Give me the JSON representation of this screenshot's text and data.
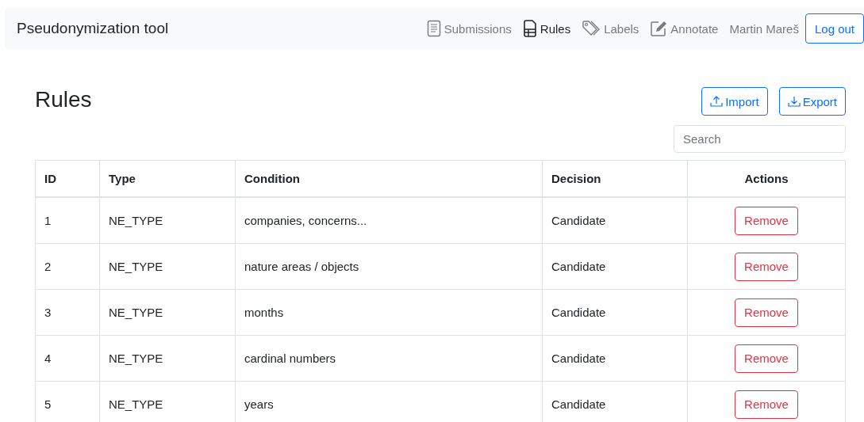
{
  "navbar": {
    "brand": "Pseudonymization tool",
    "links": [
      {
        "label": "Submissions",
        "selected": false
      },
      {
        "label": "Rules",
        "selected": true
      },
      {
        "label": "Labels",
        "selected": false
      },
      {
        "label": "Annotate",
        "selected": false
      }
    ],
    "user": "Martin Mareš",
    "logout": "Log out"
  },
  "page": {
    "title": "Rules",
    "actions": [
      "Import",
      "Export"
    ],
    "search": {
      "placeholder": "Search"
    }
  },
  "table": {
    "columns": [
      "ID",
      "Type",
      "Condition",
      "Decision",
      "Actions"
    ],
    "rows": [
      {
        "id": "1",
        "type": "NE_TYPE",
        "condition": "companies, concerns...",
        "decision": "Candidate",
        "action": "Remove"
      },
      {
        "id": "2",
        "type": "NE_TYPE",
        "condition": "nature areas / objects",
        "decision": "Candidate",
        "action": "Remove"
      },
      {
        "id": "3",
        "type": "NE_TYPE",
        "condition": "months",
        "decision": "Candidate",
        "action": "Remove"
      },
      {
        "id": "4",
        "type": "NE_TYPE",
        "condition": "cardinal numbers",
        "decision": "Candidate",
        "action": "Remove"
      },
      {
        "id": "5",
        "type": "NE_TYPE",
        "condition": "years",
        "decision": "Candidate",
        "action": "Remove"
      }
    ]
  }
}
